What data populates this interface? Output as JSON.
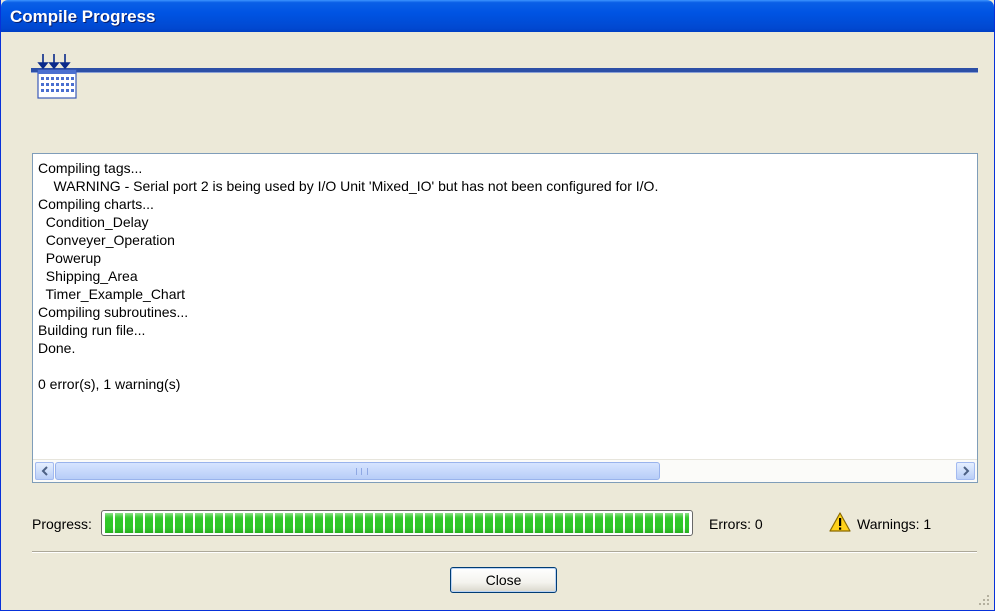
{
  "window": {
    "title": "Compile Progress"
  },
  "banner": {
    "icon": "compile-icon",
    "accent_color": "#2c4fa6"
  },
  "log": {
    "lines": [
      "Compiling tags...",
      "    WARNING - Serial port 2 is being used by I/O Unit 'Mixed_IO' but has not been configured for I/O.",
      "Compiling charts...",
      "  Condition_Delay",
      "  Conveyer_Operation",
      "  Powerup",
      "  Shipping_Area",
      "  Timer_Example_Chart",
      "Compiling subroutines...",
      "Building run file...",
      "Done.",
      "",
      "0 error(s), 1 warning(s)"
    ]
  },
  "progress": {
    "label": "Progress:",
    "fraction": 1.0,
    "fill_color": "#2fc829"
  },
  "status": {
    "errors_label": "Errors: 0",
    "warnings_label": "Warnings: 1",
    "warning_icon": "warning-icon"
  },
  "buttons": {
    "close_label": "Close"
  }
}
